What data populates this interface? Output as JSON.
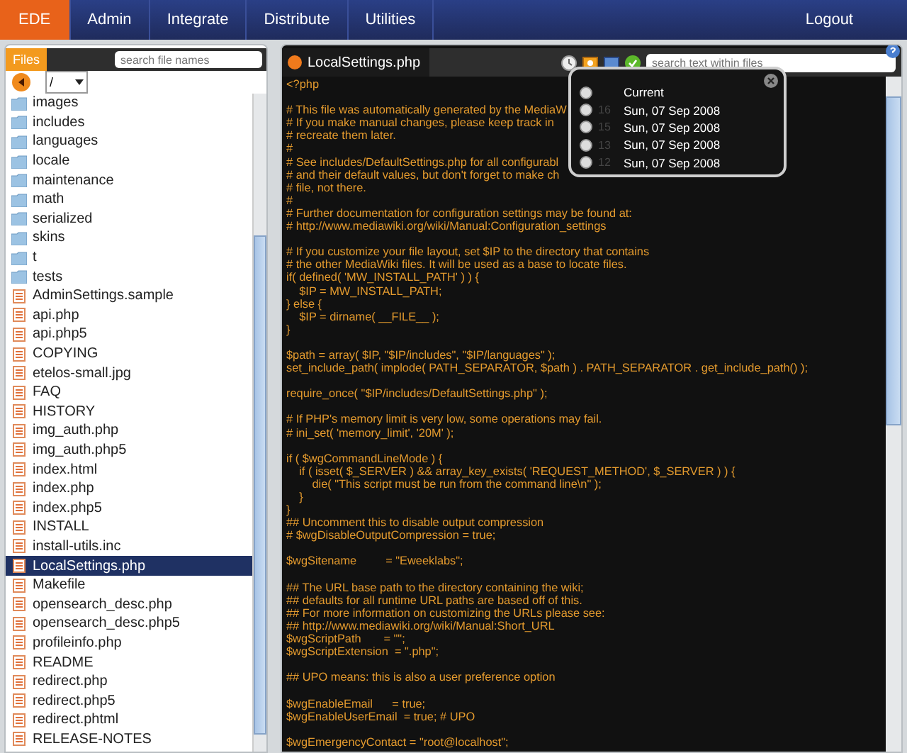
{
  "nav": {
    "items": [
      {
        "label": "EDE",
        "selected": true
      },
      {
        "label": "Admin",
        "selected": false
      },
      {
        "label": "Integrate",
        "selected": false
      },
      {
        "label": "Distribute",
        "selected": false
      },
      {
        "label": "Utilities",
        "selected": false
      }
    ],
    "logout": "Logout"
  },
  "files_panel": {
    "tab": "Files",
    "search": {
      "placeholder": "search file names"
    },
    "path": "/",
    "items": [
      {
        "name": "images",
        "kind": "folder",
        "selected": false
      },
      {
        "name": "includes",
        "kind": "folder",
        "selected": false
      },
      {
        "name": "languages",
        "kind": "folder",
        "selected": false
      },
      {
        "name": "locale",
        "kind": "folder",
        "selected": false
      },
      {
        "name": "maintenance",
        "kind": "folder",
        "selected": false
      },
      {
        "name": "math",
        "kind": "folder",
        "selected": false
      },
      {
        "name": "serialized",
        "kind": "folder",
        "selected": false
      },
      {
        "name": "skins",
        "kind": "folder",
        "selected": false
      },
      {
        "name": "t",
        "kind": "folder",
        "selected": false
      },
      {
        "name": "tests",
        "kind": "folder",
        "selected": false
      },
      {
        "name": "AdminSettings.sample",
        "kind": "file",
        "selected": false
      },
      {
        "name": "api.php",
        "kind": "file",
        "selected": false
      },
      {
        "name": "api.php5",
        "kind": "file",
        "selected": false
      },
      {
        "name": "COPYING",
        "kind": "file",
        "selected": false
      },
      {
        "name": "etelos-small.jpg",
        "kind": "file",
        "selected": false
      },
      {
        "name": "FAQ",
        "kind": "file",
        "selected": false
      },
      {
        "name": "HISTORY",
        "kind": "file",
        "selected": false
      },
      {
        "name": "img_auth.php",
        "kind": "file",
        "selected": false
      },
      {
        "name": "img_auth.php5",
        "kind": "file",
        "selected": false
      },
      {
        "name": "index.html",
        "kind": "file",
        "selected": false
      },
      {
        "name": "index.php",
        "kind": "file",
        "selected": false
      },
      {
        "name": "index.php5",
        "kind": "file",
        "selected": false
      },
      {
        "name": "INSTALL",
        "kind": "file",
        "selected": false
      },
      {
        "name": "install-utils.inc",
        "kind": "file",
        "selected": false
      },
      {
        "name": "LocalSettings.php",
        "kind": "file",
        "selected": true
      },
      {
        "name": "Makefile",
        "kind": "file",
        "selected": false
      },
      {
        "name": "opensearch_desc.php",
        "kind": "file",
        "selected": false
      },
      {
        "name": "opensearch_desc.php5",
        "kind": "file",
        "selected": false
      },
      {
        "name": "profileinfo.php",
        "kind": "file",
        "selected": false
      },
      {
        "name": "README",
        "kind": "file",
        "selected": false
      },
      {
        "name": "redirect.php",
        "kind": "file",
        "selected": false
      },
      {
        "name": "redirect.php5",
        "kind": "file",
        "selected": false
      },
      {
        "name": "redirect.phtml",
        "kind": "file",
        "selected": false
      },
      {
        "name": "RELEASE-NOTES",
        "kind": "file",
        "selected": false
      }
    ]
  },
  "editor": {
    "tab": "LocalSettings.php",
    "search": {
      "placeholder": "search text within files"
    },
    "code_blocks": [
      {
        "lines": [
          "<?php"
        ]
      },
      {
        "lines": [
          "# This file was automatically generated by the MediaW",
          "# If you make manual changes, please keep track in",
          "# recreate them later.",
          "#",
          "# See includes/DefaultSettings.php for all configurabl",
          "# and their default values, but don't forget to make ch",
          "# file, not there.",
          "#",
          "# Further documentation for configuration settings may be found at:",
          "# http://www.mediawiki.org/wiki/Manual:Configuration_settings"
        ]
      },
      {
        "lines": [
          "# If you customize your file layout, set $IP to the directory that contains",
          "# the other MediaWiki files. It will be used as a base to locate files.",
          "if( defined( 'MW_INSTALL_PATH' ) ) {",
          "\t$IP = MW_INSTALL_PATH;",
          "} else {",
          "\t$IP = dirname( __FILE__ );",
          "}"
        ]
      },
      {
        "lines": [
          "$path = array( $IP, \"$IP/includes\", \"$IP/languages\" );",
          "set_include_path( implode( PATH_SEPARATOR, $path ) . PATH_SEPARATOR . get_include_path() );"
        ]
      },
      {
        "lines": [
          "require_once( \"$IP/includes/DefaultSettings.php\" );"
        ]
      },
      {
        "lines": [
          "# If PHP's memory limit is very low, some operations may fail.",
          "# ini_set( 'memory_limit', '20M' );"
        ]
      },
      {
        "lines": [
          "if ( $wgCommandLineMode ) {",
          "\tif ( isset( $_SERVER ) && array_key_exists( 'REQUEST_METHOD', $_SERVER ) ) {",
          "\t\tdie( \"This script must be run from the command line\\n\" );",
          "\t}",
          "}",
          "## Uncomment this to disable output compression",
          "# $wgDisableOutputCompression = true;"
        ]
      },
      {
        "lines": [
          "$wgSitename         = \"Eweeklabs\";"
        ]
      },
      {
        "lines": [
          "## The URL base path to the directory containing the wiki;",
          "## defaults for all runtime URL paths are based off of this.",
          "## For more information on customizing the URLs please see:",
          "## http://www.mediawiki.org/wiki/Manual:Short_URL",
          "$wgScriptPath       = \"\";",
          "$wgScriptExtension  = \".php\";"
        ]
      },
      {
        "lines": [
          "## UPO means: this is also a user preference option"
        ]
      },
      {
        "lines": [
          "$wgEnableEmail      = true;",
          "$wgEnableUserEmail  = true; # UPO"
        ]
      },
      {
        "lines": [
          "$wgEmergencyContact = \"root@localhost\";"
        ]
      }
    ]
  },
  "revisions_popup": {
    "items": [
      {
        "label": "Current",
        "selected": false
      },
      {
        "number": "16",
        "label": "Sun, 07 Sep 2008",
        "selected": false
      },
      {
        "number": "15",
        "label": "Sun, 07 Sep 2008",
        "selected": false
      },
      {
        "number": "13",
        "label": "Sun, 07 Sep 2008",
        "selected": false
      },
      {
        "number": "12",
        "label": "Sun, 07 Sep 2008",
        "selected": false
      }
    ]
  }
}
